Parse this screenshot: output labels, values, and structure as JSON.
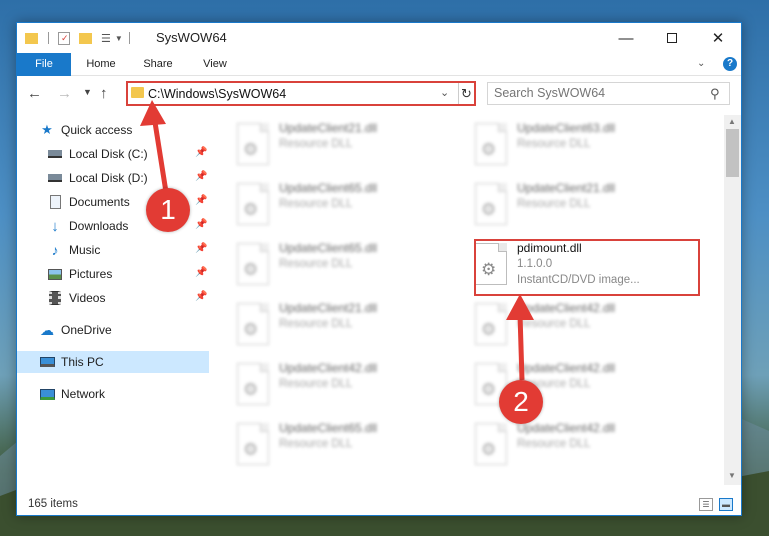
{
  "window": {
    "title": "SysWOW64"
  },
  "ribbon": {
    "tabs": [
      {
        "label": "File"
      },
      {
        "label": "Home"
      },
      {
        "label": "Share"
      },
      {
        "label": "View"
      }
    ],
    "help_label": "?"
  },
  "navigation": {
    "address": "C:\\Windows\\SysWOW64",
    "search_placeholder": "Search SysWOW64"
  },
  "sidebar": {
    "items": [
      {
        "label": "Quick access",
        "icon": "star-icon"
      },
      {
        "label": "Local Disk (C:)",
        "icon": "drive-icon"
      },
      {
        "label": "Local Disk (D:)",
        "icon": "drive-icon"
      },
      {
        "label": "Documents",
        "icon": "document-icon"
      },
      {
        "label": "Downloads",
        "icon": "download-icon"
      },
      {
        "label": "Music",
        "icon": "music-icon"
      },
      {
        "label": "Pictures",
        "icon": "picture-icon"
      },
      {
        "label": "Videos",
        "icon": "video-icon"
      },
      {
        "label": "OneDrive",
        "icon": "cloud-icon"
      },
      {
        "label": "This PC",
        "icon": "computer-icon"
      },
      {
        "label": "Network",
        "icon": "network-icon"
      }
    ]
  },
  "files": [
    {
      "name": "UpdateClient21.dll",
      "desc": "Resource DLL"
    },
    {
      "name": "UpdateClient63.dll",
      "desc": "Resource DLL"
    },
    {
      "name": "UpdateClient65.dll",
      "desc": "Resource DLL"
    },
    {
      "name": "UpdateClient21.dll",
      "desc": "Resource DLL"
    },
    {
      "name": "UpdateClient65.dll",
      "desc": "Resource DLL"
    },
    {
      "name": "pdimount.dll",
      "version": "1.1.0.0",
      "desc": "InstantCD/DVD image..."
    },
    {
      "name": "UpdateClient21.dll",
      "desc": "Resource DLL"
    },
    {
      "name": "UpdateClient42.dll",
      "desc": "Resource DLL"
    },
    {
      "name": "UpdateClient42.dll",
      "desc": "Resource DLL"
    },
    {
      "name": "UpdateClient42.dll",
      "desc": "Resource DLL"
    },
    {
      "name": "UpdateClient65.dll",
      "desc": "Resource DLL"
    },
    {
      "name": "UpdateClient42.dll",
      "desc": "Resource DLL"
    }
  ],
  "status": {
    "item_count": "165 items"
  },
  "annotations": {
    "step1": "1",
    "step2": "2"
  },
  "colors": {
    "accent": "#1979ca",
    "annotation": "#e23b34",
    "selection": "#cce8ff"
  }
}
